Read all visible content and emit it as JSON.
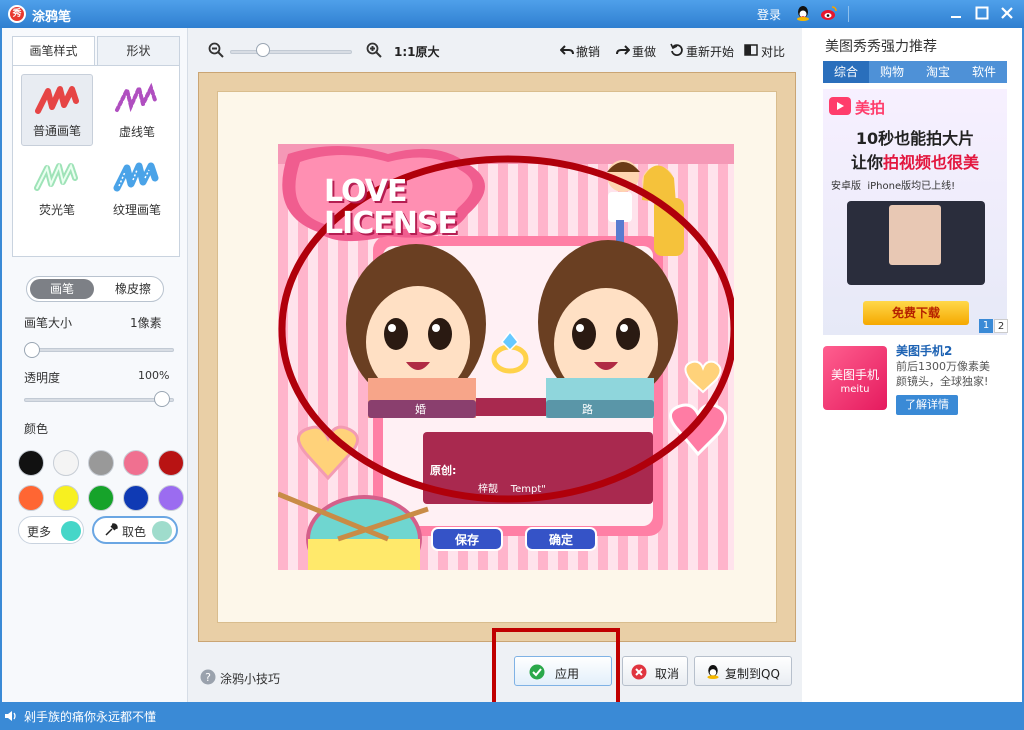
{
  "window": {
    "title": "涂鸦笔",
    "login": "登录"
  },
  "left": {
    "tabs": [
      "画笔样式",
      "形状"
    ],
    "brushes": [
      "普通画笔",
      "虚线笔",
      "荧光笔",
      "纹理画笔"
    ],
    "mode_toggle": [
      "画笔",
      "橡皮擦"
    ],
    "size_label": "画笔大小",
    "size_value": "1像素",
    "opacity_label": "透明度",
    "opacity_value": "100%",
    "opacity_level": 1.0,
    "color_label": "颜色",
    "colors": [
      "#111111",
      "#f4f4f4",
      "#999999",
      "#f07090",
      "#b81313",
      "#ff6633",
      "#f7f020",
      "#16a32a",
      "#0f3ab4",
      "#9b6cf0"
    ],
    "more_label": "更多",
    "more_color": "#45d6c8",
    "pick_label": "取色",
    "pick_color": "#9fdccc"
  },
  "toolbar": {
    "zoom_label": "1:1原大",
    "undo": "撤销",
    "redo": "重做",
    "restart": "重新开始",
    "compare": "对比"
  },
  "photo": {
    "title_line1": "LOVE",
    "title_line2": "LICENSE",
    "name_left": "婚",
    "name_right": "路",
    "original_label": "原创:",
    "original_text": "梓靓    Tempt\"",
    "save_btn": "保存",
    "confirm_btn": "确定"
  },
  "bottom": {
    "tips": "涂鸦小技巧",
    "apply": "应用",
    "cancel": "取消",
    "copy_qq": "复制到QQ"
  },
  "right": {
    "title": "美图秀秀强力推荐",
    "tabs": [
      "综合",
      "购物",
      "淘宝",
      "软件"
    ],
    "ad": {
      "brand": "美拍",
      "line1": "10秒也能拍大片",
      "line2_prefix": "让你",
      "line2_highlight": "拍视频也很美",
      "platforms": "安卓版  iPhone版均已上线!",
      "download": "免费下载",
      "pages": [
        "1",
        "2"
      ]
    },
    "promo": {
      "logo_text": "美图手机",
      "logo_sub": "meitu",
      "title": "美图手机2",
      "desc1": "前后1300万像素美",
      "desc2": "颜镜头，全球独家!",
      "link": "了解详情"
    }
  },
  "status": {
    "text": "剁手族的痛你永远都不懂"
  }
}
